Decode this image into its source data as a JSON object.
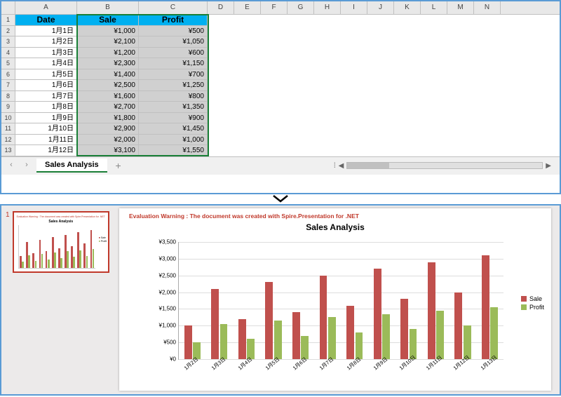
{
  "spreadsheet": {
    "columns": [
      "A",
      "B",
      "C",
      "D",
      "E",
      "F",
      "G",
      "H",
      "I",
      "J",
      "K",
      "L",
      "M",
      "N"
    ],
    "row_numbers": [
      1,
      2,
      3,
      4,
      5,
      6,
      7,
      8,
      9,
      10,
      11,
      12,
      13
    ],
    "headers": {
      "date": "Date",
      "sale": "Sale",
      "profit": "Profit"
    },
    "rows": [
      {
        "date": "1月1日",
        "sale": "¥1,000",
        "profit": "¥500"
      },
      {
        "date": "1月2日",
        "sale": "¥2,100",
        "profit": "¥1,050"
      },
      {
        "date": "1月3日",
        "sale": "¥1,200",
        "profit": "¥600"
      },
      {
        "date": "1月4日",
        "sale": "¥2,300",
        "profit": "¥1,150"
      },
      {
        "date": "1月5日",
        "sale": "¥1,400",
        "profit": "¥700"
      },
      {
        "date": "1月6日",
        "sale": "¥2,500",
        "profit": "¥1,250"
      },
      {
        "date": "1月7日",
        "sale": "¥1,600",
        "profit": "¥800"
      },
      {
        "date": "1月8日",
        "sale": "¥2,700",
        "profit": "¥1,350"
      },
      {
        "date": "1月9日",
        "sale": "¥1,800",
        "profit": "¥900"
      },
      {
        "date": "1月10日",
        "sale": "¥2,900",
        "profit": "¥1,450"
      },
      {
        "date": "1月11日",
        "sale": "¥2,000",
        "profit": "¥1,000"
      },
      {
        "date": "1月12日",
        "sale": "¥3,100",
        "profit": "¥1,550"
      }
    ],
    "sheet_tab": "Sales Analysis"
  },
  "presentation": {
    "slide_number": "1",
    "warning": "Evaluation Warning : The document was created with  Spire.Presentation for .NET",
    "legend": {
      "sale": "Sale",
      "profit": "Profit"
    }
  },
  "chart_data": {
    "type": "bar",
    "title": "Sales Analysis",
    "categories": [
      "1月2日",
      "1月3日",
      "1月4日",
      "1月5日",
      "1月6日",
      "1月7日",
      "1月8日",
      "1月9日",
      "1月10日",
      "1月11日",
      "1月12日",
      "1月13日"
    ],
    "series": [
      {
        "name": "Sale",
        "values": [
          1000,
          2100,
          1200,
          2300,
          1400,
          2500,
          1600,
          2700,
          1800,
          2900,
          2000,
          3100
        ]
      },
      {
        "name": "Profit",
        "values": [
          500,
          1050,
          600,
          1150,
          700,
          1250,
          800,
          1350,
          900,
          1450,
          1000,
          1550
        ]
      }
    ],
    "ylim": [
      0,
      3500
    ],
    "yticks": [
      "¥0",
      "¥500",
      "¥1,000",
      "¥1,500",
      "¥2,000",
      "¥2,500",
      "¥3,000",
      "¥3,500"
    ],
    "ytick_values": [
      0,
      500,
      1000,
      1500,
      2000,
      2500,
      3000,
      3500
    ],
    "xlabel": "",
    "ylabel": ""
  }
}
